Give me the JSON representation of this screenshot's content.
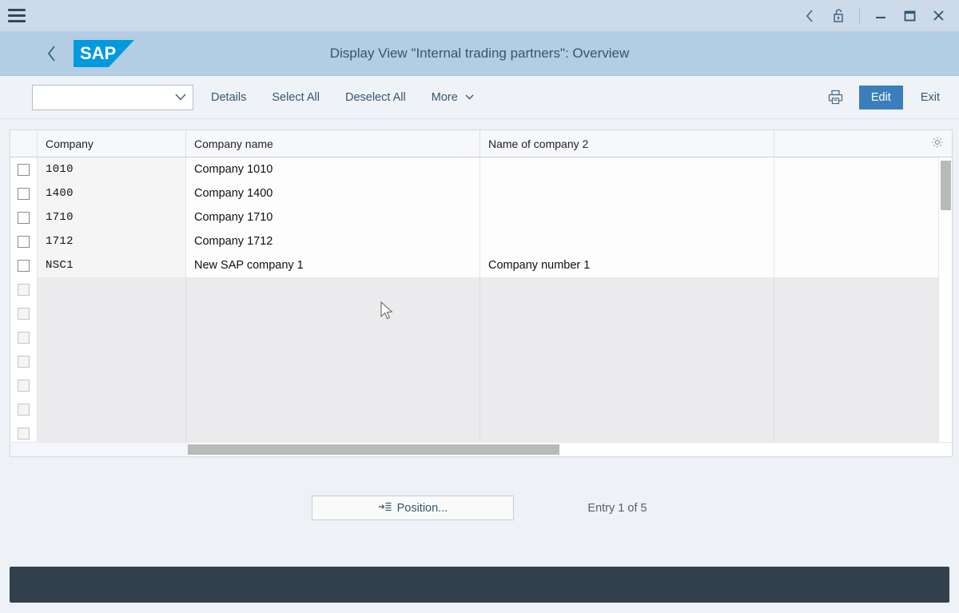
{
  "window": {
    "menu_icon": "hamburger-icon",
    "controls": [
      {
        "name": "back-icon",
        "glyph": "‹"
      },
      {
        "name": "unlock-icon",
        "glyph": "🔓"
      },
      {
        "name": "minimize-icon",
        "glyph": "—"
      },
      {
        "name": "maximize-icon",
        "glyph": "☐"
      },
      {
        "name": "close-icon",
        "glyph": "✕"
      }
    ]
  },
  "shell": {
    "back_glyph": "‹",
    "logo_text": "SAP",
    "title": "Display View \"Internal trading partners\": Overview",
    "brand_color": "#019ade",
    "header_color": "#b3cde4"
  },
  "toolbar": {
    "variant_value": "",
    "variant_placeholder": "",
    "variant_chevron": "∨",
    "details_label": "Details",
    "select_all_label": "Select All",
    "deselect_all_label": "Deselect All",
    "more_label": "More",
    "more_chevron": "∨",
    "print_icon": "printer-icon",
    "edit_label": "Edit",
    "edit_color": "#3a7fbb",
    "exit_label": "Exit"
  },
  "table": {
    "columns": [
      {
        "key": "company",
        "label": "Company"
      },
      {
        "key": "name1",
        "label": "Company name"
      },
      {
        "key": "name2",
        "label": "Name of company 2"
      },
      {
        "key": "spare",
        "label": ""
      }
    ],
    "settings_icon": "gear-icon",
    "rows": [
      {
        "company": "1010",
        "name1": "Company 1010",
        "name2": "",
        "spare": "",
        "filled": true
      },
      {
        "company": "1400",
        "name1": "Company 1400",
        "name2": "",
        "spare": "",
        "filled": true
      },
      {
        "company": "1710",
        "name1": "Company 1710",
        "name2": "",
        "spare": "",
        "filled": true
      },
      {
        "company": "1712",
        "name1": "Company 1712",
        "name2": "",
        "spare": "",
        "filled": true
      },
      {
        "company": "NSC1",
        "name1": "New SAP company 1",
        "name2": "Company number 1",
        "spare": "",
        "filled": true
      },
      {
        "company": "",
        "name1": "",
        "name2": "",
        "spare": "",
        "filled": false
      },
      {
        "company": "",
        "name1": "",
        "name2": "",
        "spare": "",
        "filled": false
      },
      {
        "company": "",
        "name1": "",
        "name2": "",
        "spare": "",
        "filled": false
      },
      {
        "company": "",
        "name1": "",
        "name2": "",
        "spare": "",
        "filled": false
      },
      {
        "company": "",
        "name1": "",
        "name2": "",
        "spare": "",
        "filled": false
      },
      {
        "company": "",
        "name1": "",
        "name2": "",
        "spare": "",
        "filled": false
      },
      {
        "company": "",
        "name1": "",
        "name2": "",
        "spare": "",
        "filled": false
      }
    ]
  },
  "footer": {
    "position_icon": "arrow-to-list-icon",
    "position_label": "Position...",
    "entry_status": "Entry 1 of 5"
  },
  "statusbar": {
    "text": "",
    "background": "#32414d"
  }
}
